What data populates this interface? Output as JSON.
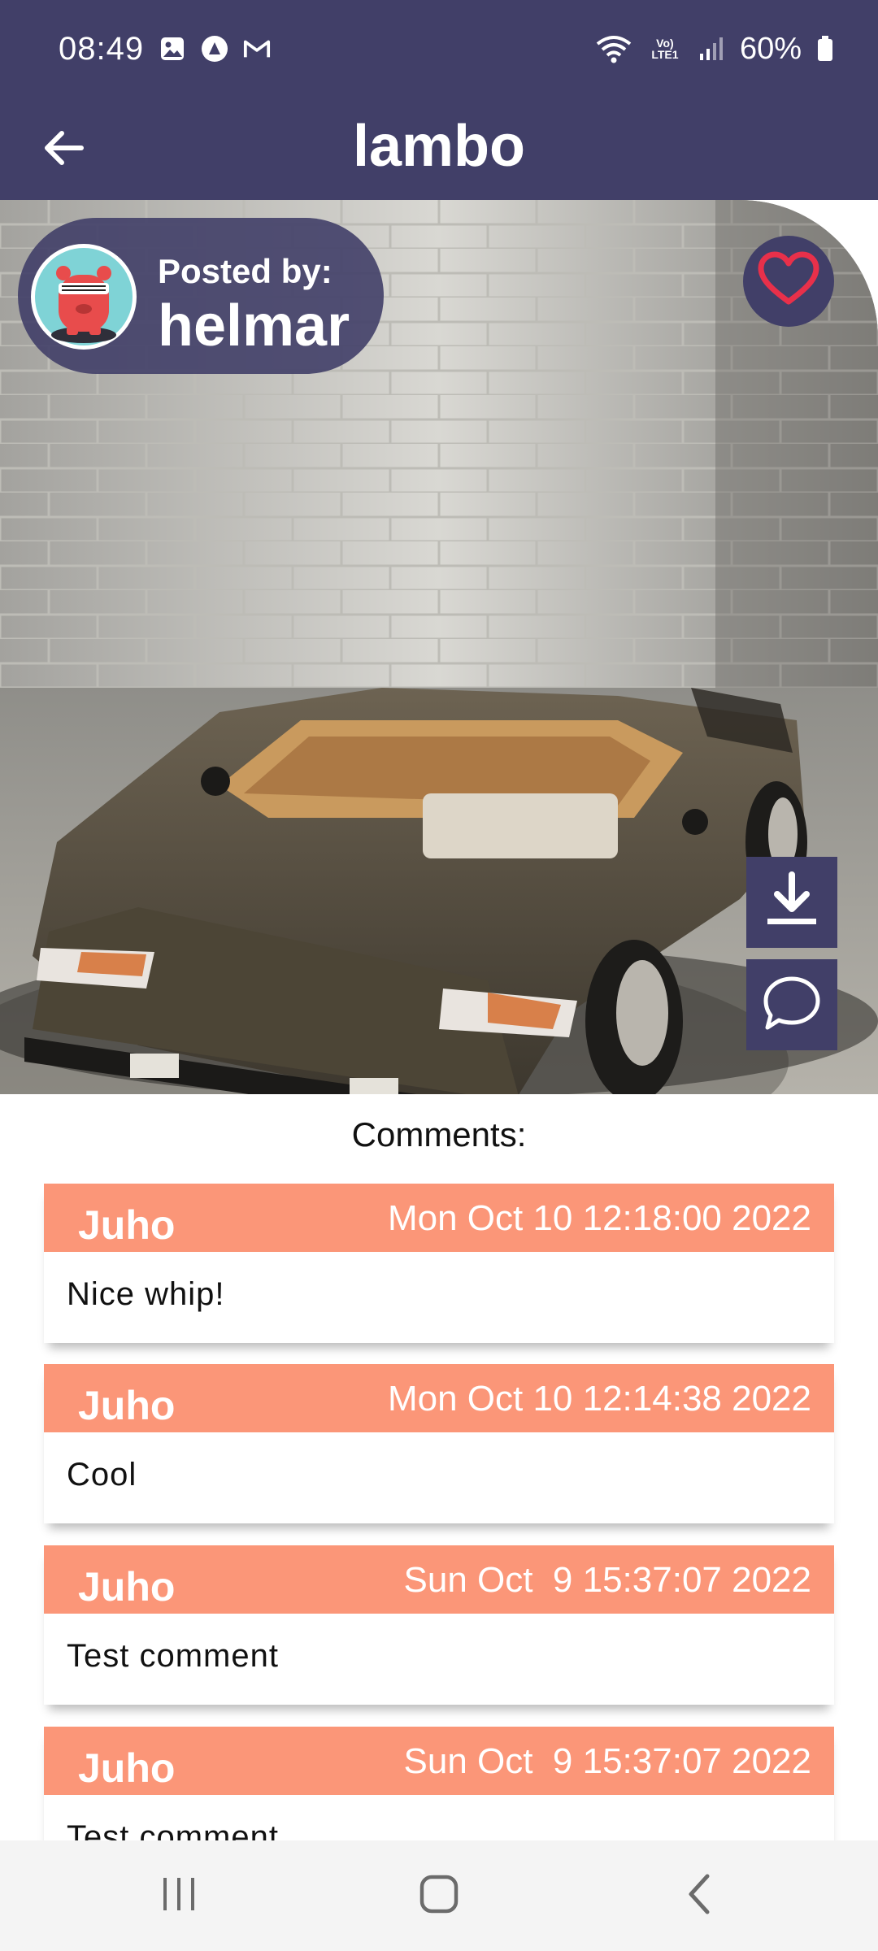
{
  "status_bar": {
    "time": "08:49",
    "network_label": "Vo) LTE1",
    "battery": "60%",
    "icons": [
      "gallery-icon",
      "app-a-icon",
      "gmail-icon",
      "wifi-icon",
      "volte-icon",
      "signal-icon",
      "battery-icon"
    ]
  },
  "app_bar": {
    "title": "lambo",
    "back_icon": "arrow-left-icon"
  },
  "post": {
    "posted_by_label": "Posted by:",
    "username": "helmar",
    "favorite_icon": "heart-outline-icon",
    "download_icon": "download-icon",
    "comment_icon": "speech-bubble-icon"
  },
  "comments": {
    "heading": "Comments:",
    "items": [
      {
        "author": "Juho",
        "time": "Mon Oct 10 12:18:00 2022",
        "text": "Nice whip!"
      },
      {
        "author": "Juho",
        "time": "Mon Oct 10 12:14:38 2022",
        "text": "Cool"
      },
      {
        "author": "Juho",
        "time": "Sun Oct  9 15:37:07 2022",
        "text": "Test comment"
      },
      {
        "author": "Juho",
        "time": "Sun Oct  9 15:37:07 2022",
        "text": "Test comment"
      }
    ]
  },
  "nav_bar": {
    "items": [
      "recents-icon",
      "home-icon",
      "back-icon"
    ]
  },
  "colors": {
    "primary": "#413f68",
    "comment_header": "#fb9678",
    "heart": "#e8304a"
  }
}
